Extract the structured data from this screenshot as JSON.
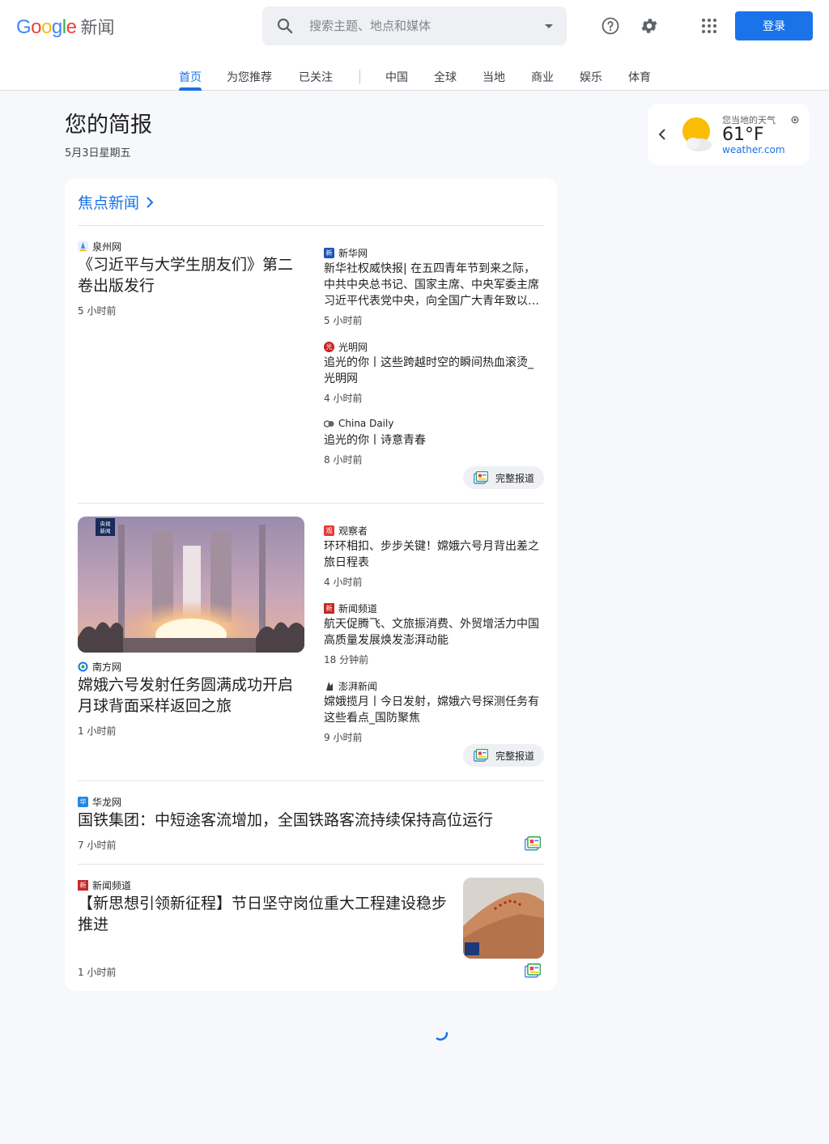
{
  "header": {
    "logo_letters": [
      "G",
      "o",
      "o",
      "g",
      "l",
      "e"
    ],
    "logo_colors": [
      "#4285f4",
      "#ea4335",
      "#fbbc04",
      "#4285f4",
      "#34a853",
      "#ea4335"
    ],
    "logo_product": "新闻",
    "search_placeholder": "搜索主题、地点和媒体",
    "signin_label": "登录",
    "accent_color": "#1a73e8"
  },
  "nav": {
    "tabs": [
      "首页",
      "为您推荐",
      "已关注",
      "中国",
      "全球",
      "当地",
      "商业",
      "娱乐",
      "体育"
    ],
    "active_tab": "首页"
  },
  "briefing": {
    "title": "您的简报",
    "date": "5月3日星期五"
  },
  "weather": {
    "label": "您当地的天气",
    "temperature": "61°F",
    "source": "weather.com"
  },
  "top_stories": {
    "heading": "焦点新闻",
    "full_coverage_label": "完整报道",
    "clusters": [
      {
        "main": {
          "source": "泉州网",
          "headline": "《习近平与大学生朋友们》第二卷出版发行",
          "time": "5 小时前"
        },
        "related": [
          {
            "source": "新华网",
            "headline": "新华社权威快报| 在五四青年节到来之际，中共中央总书记、国家主席、中央军委主席习近平代表党中央，向全国广大青年致以…",
            "time": "5 小时前"
          },
          {
            "source": "光明网",
            "headline": "追光的你丨这些跨越时空的瞬间热血滚烫_光明网",
            "time": "4 小时前"
          },
          {
            "source": "China Daily",
            "headline": "追光的你丨诗意青春",
            "time": "8 小时前"
          }
        ]
      },
      {
        "main": {
          "source": "南方网",
          "headline": "嫦娥六号发射任务圆满成功开启月球背面采样返回之旅",
          "time": "1 小时前",
          "image_logo": "央视新闻"
        },
        "related": [
          {
            "source": "观察者",
            "headline": "环环相扣、步步关键！嫦娥六号月背出差之旅日程表",
            "time": "4 小时前"
          },
          {
            "source": "新闻频道",
            "headline": "航天促腾飞、文旅振消费、外贸增活力中国高质量发展焕发澎湃动能",
            "time": "18 分钟前"
          },
          {
            "source": "澎湃新闻",
            "headline": "嫦娥揽月丨今日发射，嫦娥六号探测任务有这些看点_国防聚焦",
            "time": "9 小时前"
          }
        ]
      },
      {
        "source": "华龙网",
        "headline": "国铁集团：中短途客流增加，全国铁路客流持续保持高位运行",
        "time": "7 小时前"
      },
      {
        "source": "新闻频道",
        "headline": "【新思想引领新征程】节日坚守岗位重大工程建设稳步推进",
        "time": "1 小时前"
      }
    ]
  }
}
